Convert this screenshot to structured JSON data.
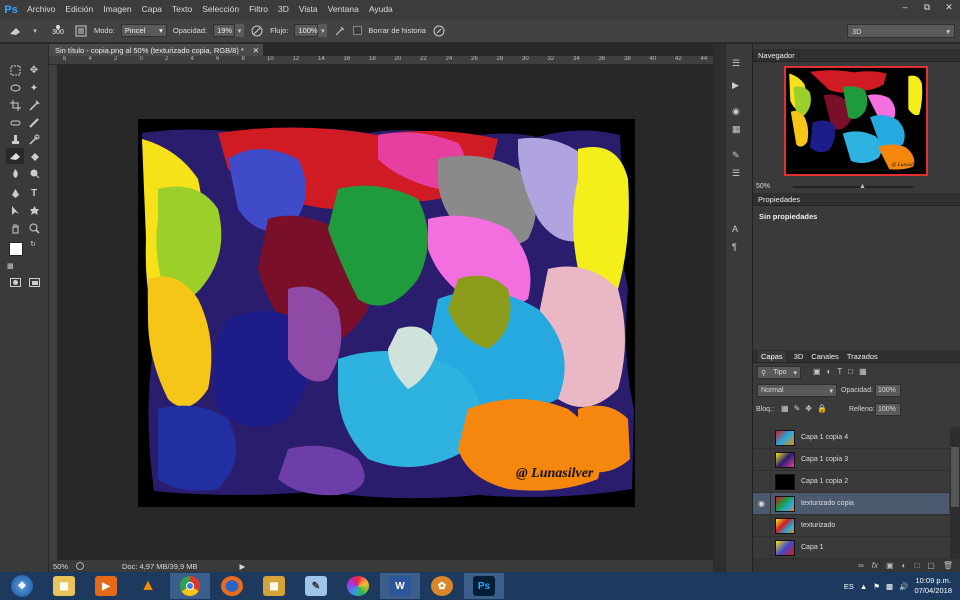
{
  "app": {
    "logo": "Ps"
  },
  "menu": [
    "Archivo",
    "Edición",
    "Imagen",
    "Capa",
    "Texto",
    "Selección",
    "Filtro",
    "3D",
    "Vista",
    "Ventana",
    "Ayuda"
  ],
  "options": {
    "brush_size": "300",
    "mode_label": "Modo:",
    "mode_value": "Pincel",
    "opacity_label": "Opacidad:",
    "opacity_value": "19%",
    "flow_label": "Flujo:",
    "flow_value": "100%",
    "erase_history_label": "Borrar de historia",
    "workspace": "3D"
  },
  "document": {
    "tab_title": "Sin título - copia.png al 50% (texturizado copia, RGB/8) *",
    "zoom": "50%",
    "doc_info": "Doc: 4,97 MB/39,9 MB",
    "watermark": "@ Lunasilver"
  },
  "ruler_ticks": [
    "6",
    "4",
    "2",
    "0",
    "2",
    "4",
    "6",
    "8",
    "10",
    "12",
    "14",
    "16",
    "18",
    "20",
    "22",
    "24",
    "26",
    "28",
    "30",
    "32",
    "34",
    "36",
    "38",
    "40",
    "42",
    "44"
  ],
  "navigator": {
    "title": "Navegador",
    "zoom": "50%",
    "watermark": "@ Lunasilver"
  },
  "properties": {
    "title": "Propiedades",
    "empty": "Sin propiedades"
  },
  "layers": {
    "tabs": [
      "Capas",
      "3D",
      "Canales",
      "Trazados"
    ],
    "filter": "Tipo",
    "blend_mode": "Normal",
    "opacity_label": "Opacidad:",
    "opacity_value": "100%",
    "lock_label": "Bloq.:",
    "fill_label": "Relleno:",
    "fill_value": "100%",
    "items": [
      {
        "name": "Capa 1 copia 4",
        "visible": false,
        "selected": false
      },
      {
        "name": "Capa 1 copia 3",
        "visible": false,
        "selected": false
      },
      {
        "name": "Capa 1 copia 2",
        "visible": false,
        "selected": false
      },
      {
        "name": "texturizado copia",
        "visible": true,
        "selected": true
      },
      {
        "name": "texturizado",
        "visible": false,
        "selected": false
      },
      {
        "name": "Capa 1",
        "visible": false,
        "selected": false
      }
    ]
  },
  "taskbar": {
    "apps": [
      "start",
      "explorer",
      "media-player",
      "vlc",
      "chrome",
      "firefox",
      "archive",
      "paint",
      "picasa",
      "word",
      "launcher",
      "photoshop"
    ],
    "lang": "ES",
    "time": "10:09 p.m.",
    "date": "07/04/2018"
  },
  "colors": {
    "accent": "#31a8ff",
    "taskbar": "#1d3a5e",
    "selected_layer": "#4c5a70"
  }
}
